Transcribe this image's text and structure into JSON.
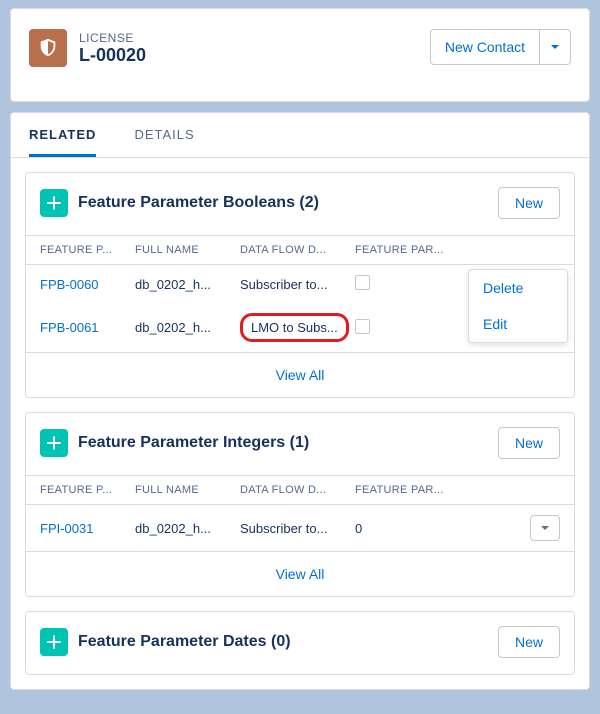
{
  "header": {
    "objectLabel": "LICENSE",
    "title": "L-00020",
    "newContactLabel": "New Contact"
  },
  "tabs": {
    "related": "RELATED",
    "details": "DETAILS"
  },
  "common": {
    "new": "New",
    "viewAll": "View All"
  },
  "sections": {
    "booleans": {
      "title": "Feature Parameter Booleans (2)",
      "cols": [
        "FEATURE P...",
        "FULL NAME",
        "DATA FLOW D...",
        "FEATURE PAR..."
      ],
      "rows": [
        {
          "id": "FPB-0060",
          "fullName": "db_0202_h...",
          "flow": "Subscriber to..."
        },
        {
          "id": "FPB-0061",
          "fullName": "db_0202_h...",
          "flow": "LMO to Subs..."
        }
      ]
    },
    "integers": {
      "title": "Feature Parameter Integers (1)",
      "cols": [
        "FEATURE P...",
        "FULL NAME",
        "DATA FLOW D...",
        "FEATURE PAR..."
      ],
      "rows": [
        {
          "id": "FPI-0031",
          "fullName": "db_0202_h...",
          "flow": "Subscriber to...",
          "val": "0"
        }
      ]
    },
    "dates": {
      "title": "Feature Parameter Dates (0)"
    }
  },
  "menu": {
    "delete": "Delete",
    "edit": "Edit"
  }
}
